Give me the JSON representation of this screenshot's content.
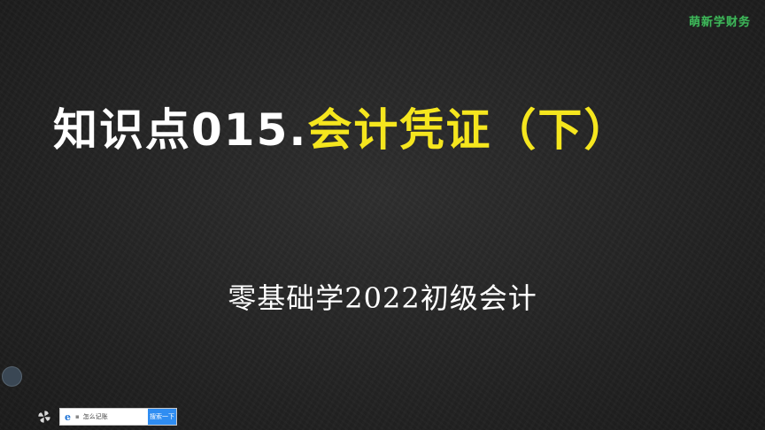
{
  "watermark": {
    "text": "萌新学财务"
  },
  "title": {
    "prefix": "知识点015.",
    "topic": "会计凭证（下）"
  },
  "subtitle": "零基础学2022初级会计",
  "colors": {
    "background": "#262626",
    "title_prefix": "#ffffff",
    "title_topic": "#f5e61e",
    "watermark": "#3fb55a",
    "search_button": "#2f8df2"
  },
  "taskbar": {
    "app_icon": "pinwheel-icon",
    "search": {
      "browser_icon": "ie-browser-icon",
      "value": "怎么记账",
      "button_label": "搜索一下"
    }
  }
}
